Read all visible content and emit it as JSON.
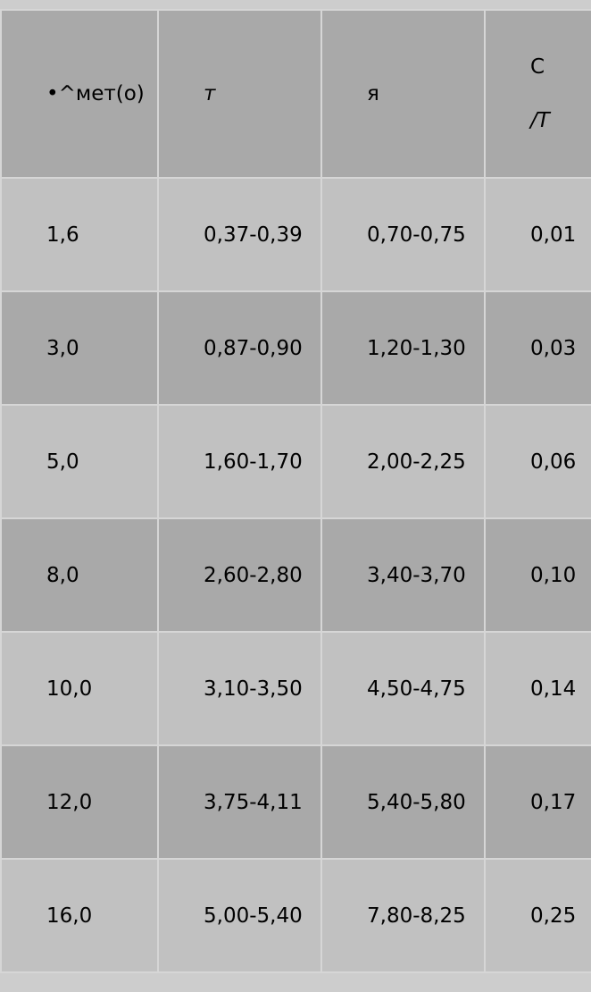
{
  "header": {
    "col0": "•^мет(о)",
    "col1": "т",
    "col2": "я",
    "col3_top": "С",
    "col3_bottom": "/Т"
  },
  "rows": [
    [
      "1,6",
      "0,37-0,39",
      "0,70-0,75",
      "0,01"
    ],
    [
      "3,0",
      "0,87-0,90",
      "1,20-1,30",
      "0,03"
    ],
    [
      "5,0",
      "1,60-1,70",
      "2,00-2,25",
      "0,06"
    ],
    [
      "8,0",
      "2,60-2,80",
      "3,40-3,70",
      "0,10"
    ],
    [
      "10,0",
      "3,10-3,50",
      "4,50-4,75",
      "0,14"
    ],
    [
      "12,0",
      "3,75-4,11",
      "5,40-5,80",
      "0,17"
    ],
    [
      "16,0",
      "5,00-5,40",
      "7,80-8,25",
      "0,25"
    ]
  ]
}
